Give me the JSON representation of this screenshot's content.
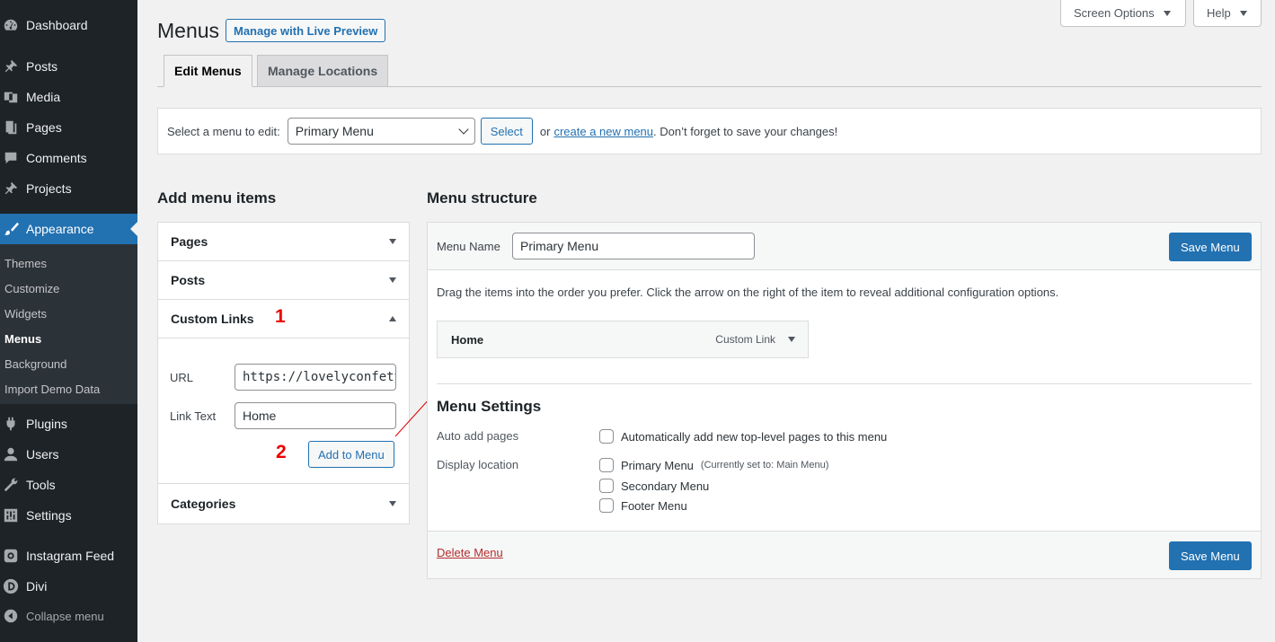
{
  "sidebar": {
    "items": [
      {
        "label": "Dashboard",
        "icon": "dashboard-icon"
      },
      {
        "label": "Posts",
        "icon": "pin-icon"
      },
      {
        "label": "Media",
        "icon": "media-icon"
      },
      {
        "label": "Pages",
        "icon": "pages-icon"
      },
      {
        "label": "Comments",
        "icon": "comments-icon"
      },
      {
        "label": "Projects",
        "icon": "pin-icon"
      },
      {
        "label": "Appearance",
        "icon": "brush-icon",
        "active": true
      },
      {
        "label": "Plugins",
        "icon": "plugin-icon"
      },
      {
        "label": "Users",
        "icon": "users-icon"
      },
      {
        "label": "Tools",
        "icon": "wrench-icon"
      },
      {
        "label": "Settings",
        "icon": "settings-icon"
      },
      {
        "label": "Instagram Feed",
        "icon": "instagram-icon"
      },
      {
        "label": "Divi",
        "icon": "divi-icon"
      },
      {
        "label": "Collapse menu",
        "icon": "collapse-icon"
      }
    ],
    "submenu": [
      "Themes",
      "Customize",
      "Widgets",
      "Menus",
      "Background",
      "Import Demo Data"
    ],
    "current_sub": "Menus"
  },
  "header": {
    "screen_options": "Screen Options",
    "help": "Help",
    "title": "Menus",
    "live_preview": "Manage with Live Preview"
  },
  "tabs": [
    "Edit Menus",
    "Manage Locations"
  ],
  "select_bar": {
    "label": "Select a menu to edit:",
    "selected": "Primary Menu",
    "select_button": "Select",
    "or": "or",
    "create_link": "create a new menu",
    "suffix": ". Don’t forget to save your changes!"
  },
  "add_items": {
    "heading": "Add menu items",
    "sections": [
      "Pages",
      "Posts",
      "Custom Links",
      "Categories"
    ],
    "url_label": "URL",
    "url_value": "https://lovelyconfetti.com",
    "link_text_label": "Link Text",
    "link_text_value": "Home",
    "add_button": "Add to Menu"
  },
  "annotations": {
    "one": "1",
    "two": "2",
    "arrow_color": "#e00000"
  },
  "structure": {
    "heading": "Menu structure",
    "menu_name_label": "Menu Name",
    "menu_name_value": "Primary Menu",
    "save_button": "Save Menu",
    "instructions": "Drag the items into the order you prefer. Click the arrow on the right of the item to reveal additional configuration options.",
    "item_title": "Home",
    "item_type": "Custom Link",
    "settings_heading": "Menu Settings",
    "auto_add_label": "Auto add pages",
    "auto_add_option": "Automatically add new top-level pages to this menu",
    "display_location_label": "Display location",
    "locations": [
      {
        "label": "Primary Menu",
        "note": "(Currently set to: Main Menu)"
      },
      {
        "label": "Secondary Menu",
        "note": ""
      },
      {
        "label": "Footer Menu",
        "note": ""
      }
    ],
    "delete_link": "Delete Menu"
  },
  "colors": {
    "accent": "#2271b1",
    "sidebar_bg": "#1d2327",
    "delete": "#b32d2e"
  }
}
